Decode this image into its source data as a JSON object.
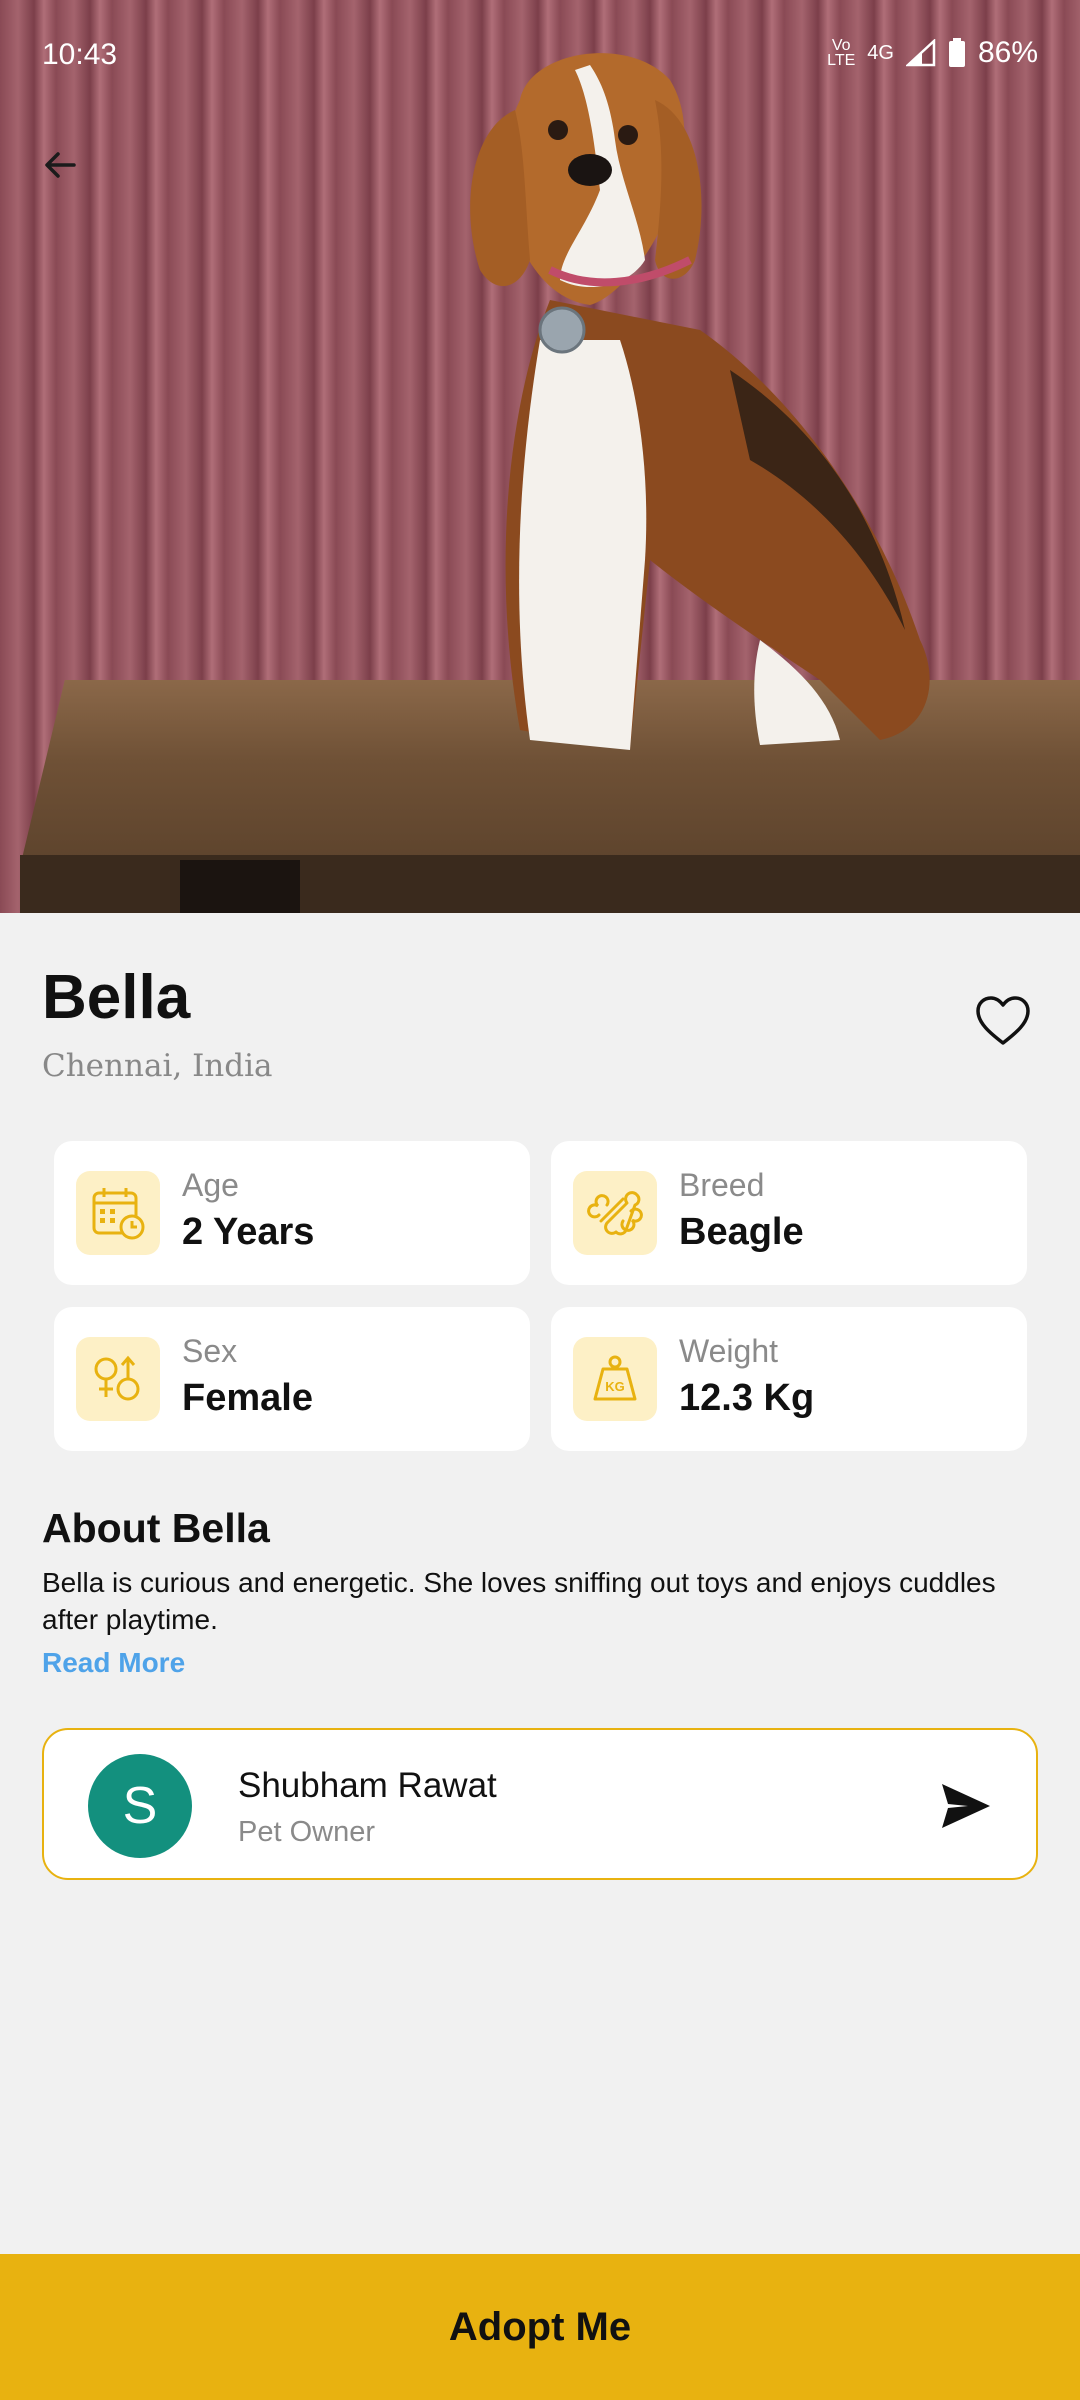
{
  "status_bar": {
    "time": "10:43",
    "network": "4G",
    "battery": "86%"
  },
  "pet": {
    "name": "Bella",
    "location": "Chennai, India"
  },
  "attributes": [
    {
      "label": "Age",
      "value": "2 Years",
      "icon": "calendar-icon"
    },
    {
      "label": "Breed",
      "value": "Beagle",
      "icon": "bone-icon"
    },
    {
      "label": "Sex",
      "value": "Female",
      "icon": "gender-icon"
    },
    {
      "label": "Weight",
      "value": "12.3 Kg",
      "icon": "weight-icon"
    }
  ],
  "about": {
    "heading": "About Bella",
    "text": "Bella is curious and energetic. She loves sniffing out toys and enjoys cuddles after playtime.",
    "read_more": "Read More"
  },
  "owner": {
    "initial": "S",
    "name": "Shubham Rawat",
    "role": "Pet Owner"
  },
  "cta": {
    "label": "Adopt Me"
  },
  "colors": {
    "accent": "#e8b210",
    "avatar": "#13907e",
    "link": "#4fa3e9",
    "icon_bg": "#fdf0c6"
  }
}
